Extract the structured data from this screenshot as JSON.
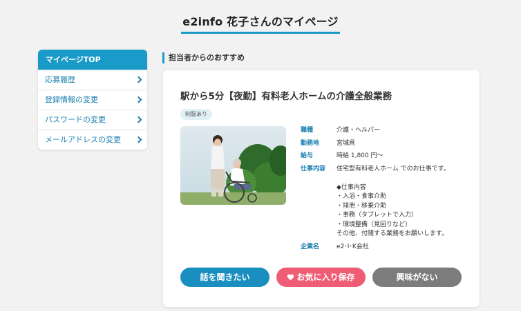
{
  "page": {
    "title": "e2info 花子さんのマイページ"
  },
  "sidebar": {
    "header": "マイページTOP",
    "items": [
      {
        "label": "応募履歴"
      },
      {
        "label": "登録情報の変更"
      },
      {
        "label": "パスワードの変更"
      },
      {
        "label": "メールアドレスの変更"
      }
    ]
  },
  "section": {
    "title": "担当者からのおすすめ"
  },
  "job": {
    "title": "駅から5分【夜勤】有料老人ホームの介護全般業務",
    "tag": "制服あり",
    "fields": {
      "category_label": "職種",
      "category": "介護・ヘルパー",
      "location_label": "勤務地",
      "location": "宮城県",
      "salary_label": "給与",
      "salary": "時給 1,800 円〜",
      "content_label": "仕事内容",
      "content_intro": "住宅型有料老人ホーム でのお仕事です。",
      "content_heading": "◆仕事内容",
      "content_lines": [
        "・入浴・食事介助",
        "・排泄・移乗介助",
        "・事務（タブレットで入力）",
        "・環境整備（見回りなど）",
        "その他、付随する業務をお願いします。"
      ],
      "company_label": "企業名",
      "company": "e2･I･K会社"
    }
  },
  "buttons": {
    "talk": "話を聞きたい",
    "favorite": "お気に入り保存",
    "not_interested": "興味がない"
  },
  "colors": {
    "accent": "#1a9ac9",
    "favorite": "#ee5d73",
    "neutral": "#7c7c7c"
  }
}
